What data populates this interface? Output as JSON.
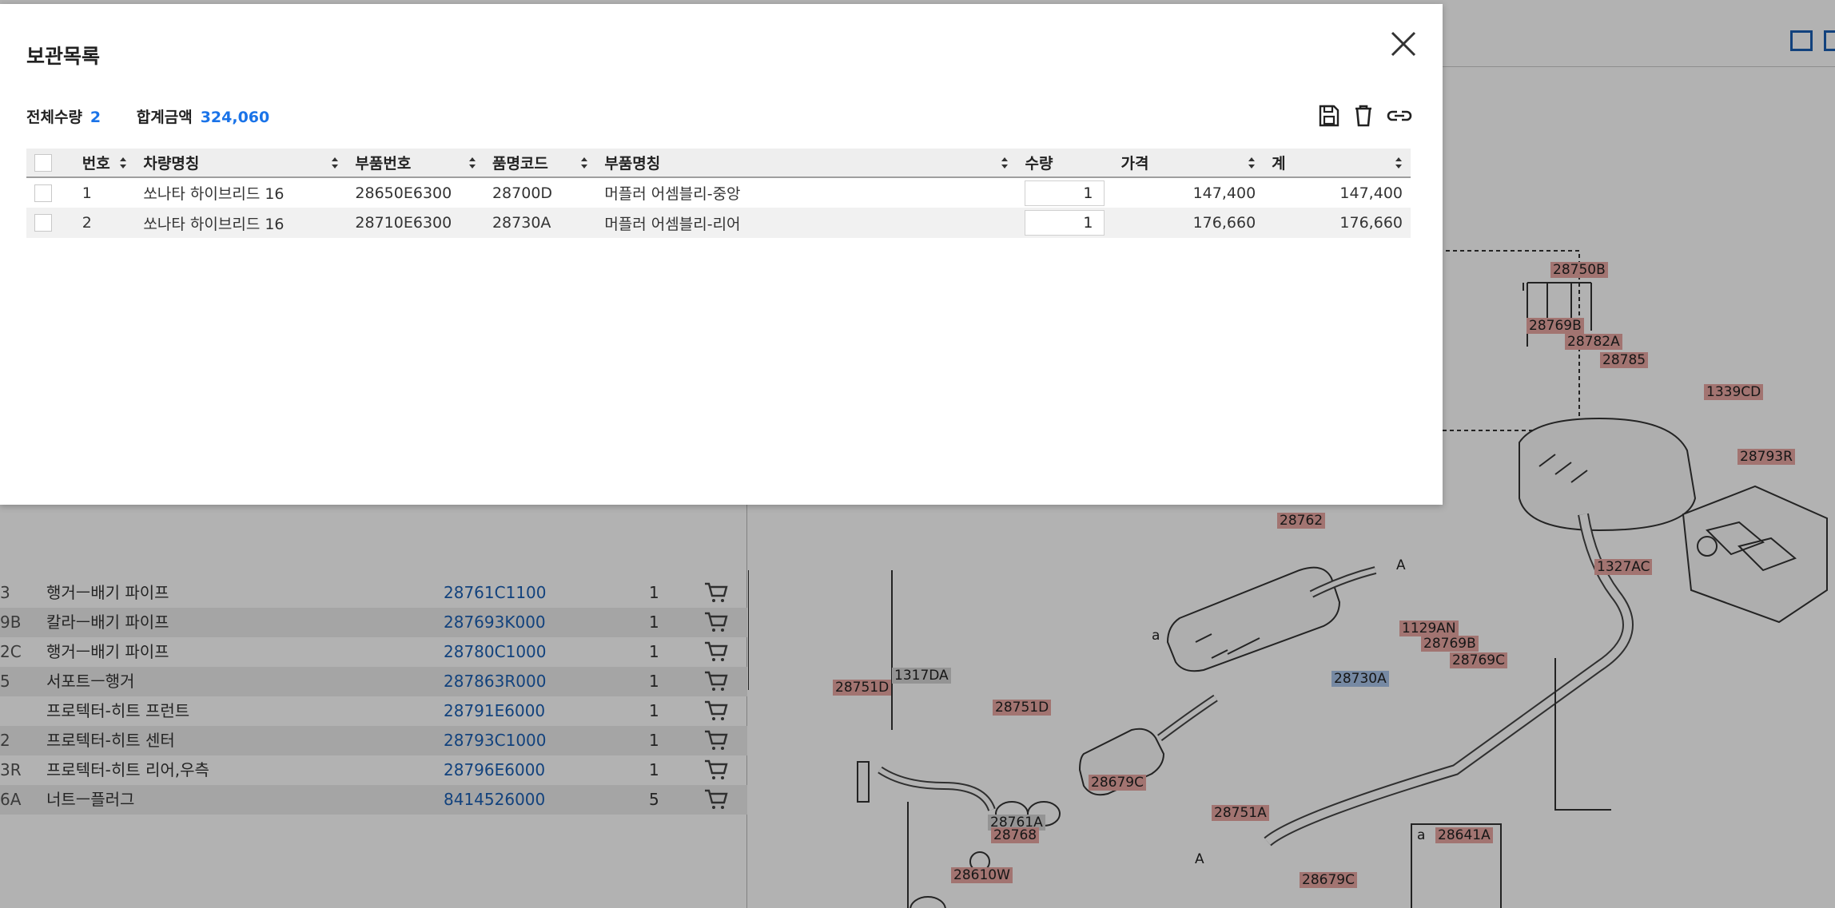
{
  "modal": {
    "title": "보관목록",
    "summary": {
      "total_qty_label": "전체수량",
      "total_qty_value": "2",
      "total_amount_label": "합계금액",
      "total_amount_value": "324,060"
    },
    "actions": [
      "save-icon",
      "trash-icon",
      "link-icon"
    ],
    "table": {
      "headers": {
        "no": "번호",
        "vehicle": "차량명칭",
        "part_no": "부품번호",
        "item_code": "품명코드",
        "part_name": "부품명칭",
        "qty": "수량",
        "price": "가격",
        "total": "계"
      },
      "rows": [
        {
          "no": "1",
          "vehicle": "쏘나타 하이브리드 16",
          "part_no": "28650E6300",
          "item_code": "28700D",
          "part_name": "머플러 어셈블리-중앙",
          "qty": "1",
          "price": "147,400",
          "total": "147,400"
        },
        {
          "no": "2",
          "vehicle": "쏘나타 하이브리드 16",
          "part_no": "28710E6300",
          "item_code": "28730A",
          "part_name": "머플러 어셈블리-리어",
          "qty": "1",
          "price": "176,660",
          "total": "176,660"
        }
      ]
    }
  },
  "background": {
    "parts_list": [
      {
        "code": "3",
        "name": "행거ㅡ배기 파이프",
        "part_no": "28761C1100",
        "qty": "1"
      },
      {
        "code": "9B",
        "name": "칼라ㅡ배기 파이프",
        "part_no": "287693K000",
        "qty": "1"
      },
      {
        "code": "2C",
        "name": "행거ㅡ배기 파이프",
        "part_no": "28780C1000",
        "qty": "1"
      },
      {
        "code": "5",
        "name": "서포트ㅡ행거",
        "part_no": "287863R000",
        "qty": "1"
      },
      {
        "code": "",
        "name": "프로텍터-히트 프런트",
        "part_no": "28791E6000",
        "qty": "1"
      },
      {
        "code": "2",
        "name": "프로텍터-히트 센터",
        "part_no": "28793C1000",
        "qty": "1"
      },
      {
        "code": "3R",
        "name": "프로텍터-히트 리어,우측",
        "part_no": "28796E6000",
        "qty": "1"
      },
      {
        "code": "6A",
        "name": "너트ㅡ플러그",
        "part_no": "8414526000",
        "qty": "5"
      }
    ],
    "diagram_callouts": {
      "c28750B": "28750B",
      "c28769B_top": "28769B",
      "c28782A": "28782A",
      "c28785": "28785",
      "c1339CD": "1339CD",
      "c28793R": "28793R",
      "c28762": "28762",
      "cA1": "A",
      "c1327AC": "1327AC",
      "c1129AN": "1129AN",
      "c28769B": "28769B",
      "c28769C": "28769C",
      "c28730A": "28730A",
      "c1317DA": "1317DA",
      "c28751D_left": "28751D",
      "c28751D_mid": "28751D",
      "ca": "a",
      "c28679C_mid": "28679C",
      "c28761A": "28761A",
      "c28768": "28768",
      "c28610W": "28610W",
      "c28751A": "28751A",
      "cA2": "A",
      "c28679C_bot": "28679C",
      "ca2": "a",
      "c28641A": "28641A"
    }
  },
  "colors": {
    "accent": "#1a73e8",
    "link_blue": "#1a5fb4",
    "callout_red": "#e8a7a2",
    "callout_blue": "#a9c4ea"
  }
}
